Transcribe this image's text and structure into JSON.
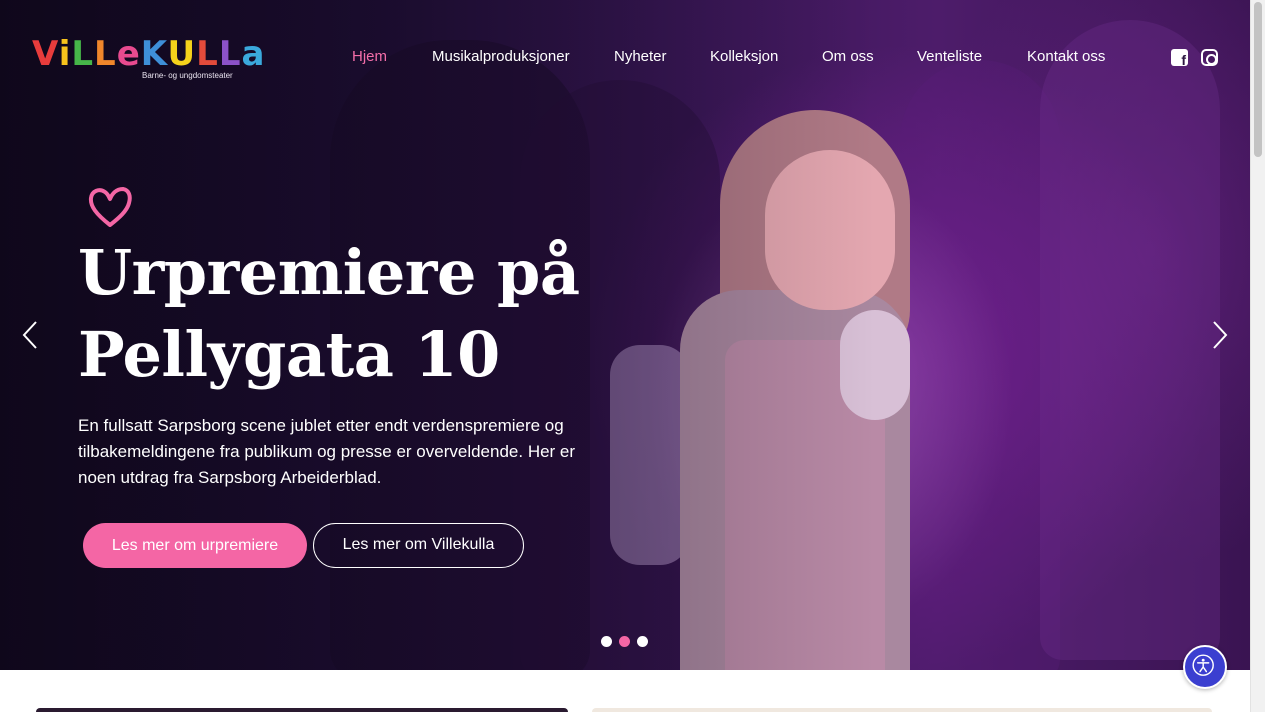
{
  "brand": {
    "logo_letters": [
      "V",
      "i",
      "L",
      "L",
      "e",
      "K",
      "U",
      "L",
      "L",
      "a"
    ],
    "logo_colors": [
      "#e83c3c",
      "#f7c21c",
      "#46b649",
      "#f0862b",
      "#e84a8f",
      "#3e8fd8",
      "#f5d21b",
      "#e34b3b",
      "#8c52c8",
      "#3ba9dc"
    ],
    "tagline": "Barne- og ungdomsteater"
  },
  "nav": {
    "items": [
      {
        "label": "Hjem",
        "active": true
      },
      {
        "label": "Musikalproduksjoner",
        "active": false
      },
      {
        "label": "Nyheter",
        "active": false
      },
      {
        "label": "Kolleksjon",
        "active": false
      },
      {
        "label": "Om oss",
        "active": false
      },
      {
        "label": "Venteliste",
        "active": false
      },
      {
        "label": "Kontakt oss",
        "active": false
      }
    ],
    "social": [
      "facebook-icon",
      "instagram-icon"
    ]
  },
  "hero": {
    "title_line1": "Urpremiere på",
    "title_line2": "Pellygata 10",
    "description": "En fullsatt Sarpsborg scene jublet etter endt verdenspremiere og tilbakemeldingene fra publikum og presse er overveldende. Her er noen utdrag fra Sarpsborg Arbeiderblad.",
    "primary_button": "Les mer om urpremiere",
    "secondary_button": "Les mer om Villekulla",
    "slide_count": 3,
    "active_slide": 2
  },
  "colors": {
    "accent": "#f466a5",
    "accessibility": "#3b3fd0"
  }
}
